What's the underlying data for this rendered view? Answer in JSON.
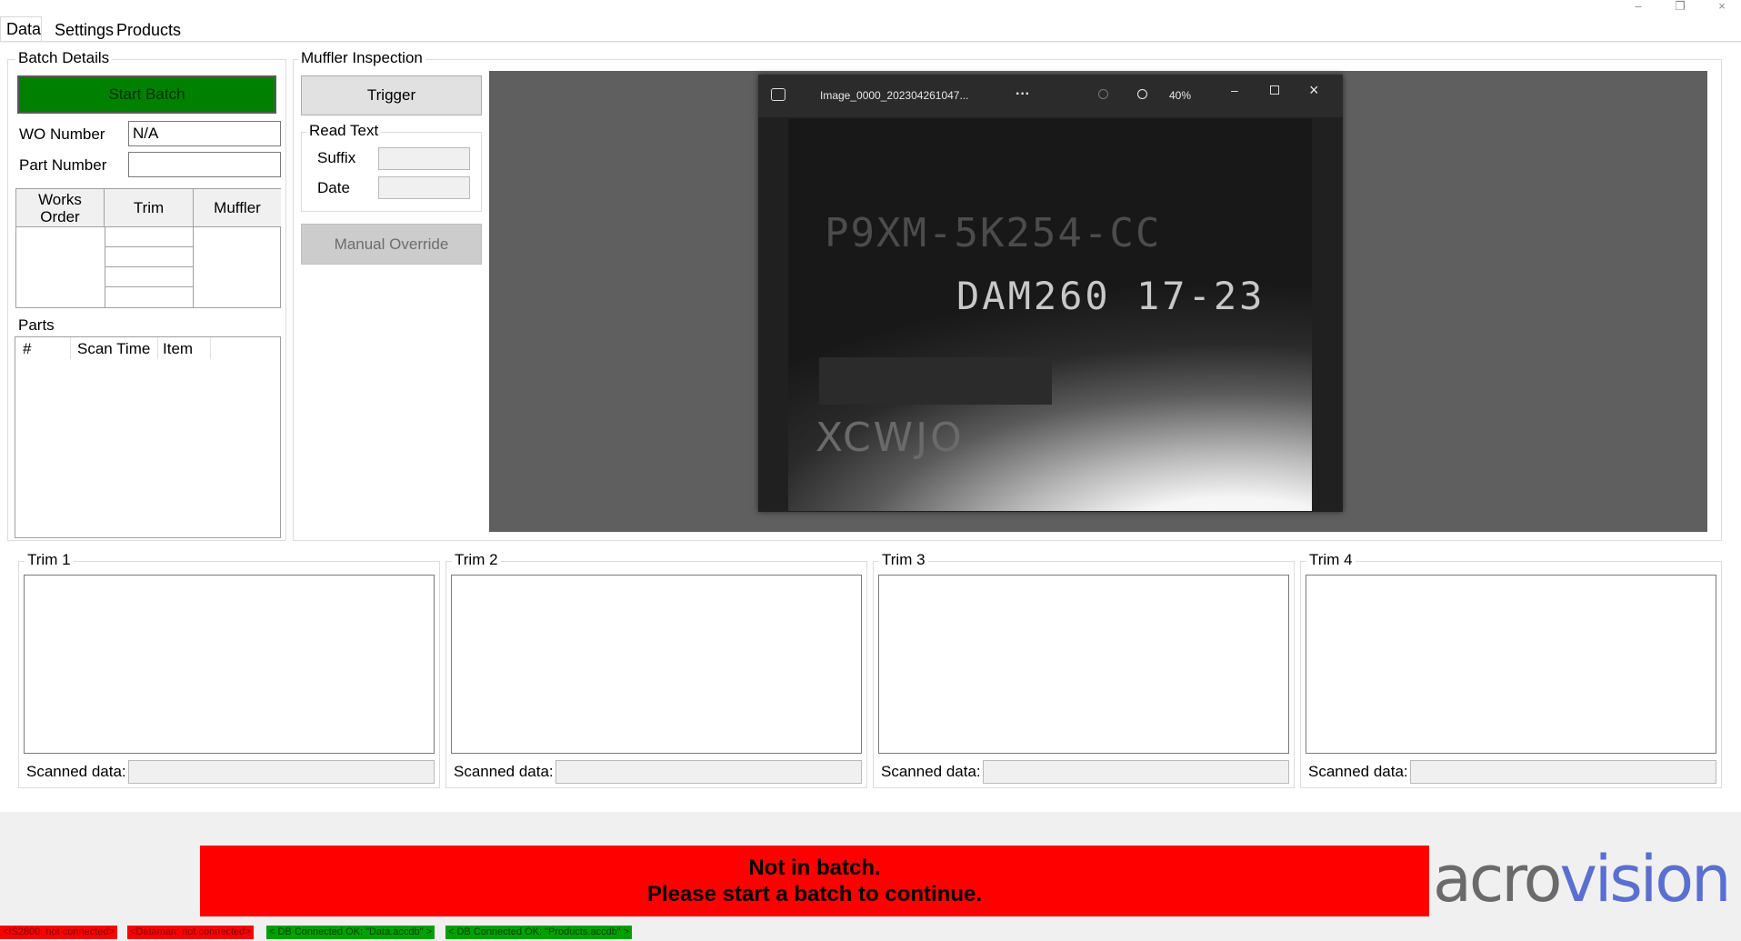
{
  "tabs": [
    "Data",
    "Settings",
    "Products"
  ],
  "window_controls": {
    "minimize": "–",
    "restore": "❐",
    "close": "×"
  },
  "batch_details": {
    "title": "Batch Details",
    "start_button": "Start Batch",
    "wo_number_label": "WO Number",
    "wo_number_value": "N/A",
    "part_number_label": "Part Number",
    "part_number_value": "",
    "grid_headers": {
      "works_order": "Works\nOrder",
      "trim": "Trim",
      "muffler": "Muffler"
    }
  },
  "parts": {
    "title": "Parts",
    "columns": [
      "#",
      "Scan Time",
      "Item"
    ]
  },
  "muffler_inspection": {
    "title": "Muffler Inspection",
    "trigger_button": "Trigger",
    "read_text_title": "Read Text",
    "suffix_label": "Suffix",
    "date_label": "Date",
    "manual_override_button": "Manual Override"
  },
  "photo_viewer": {
    "filename": "Image_0000_202304261047...",
    "more": "···",
    "zoom": "40%",
    "image_lines": [
      "P9XM-5K254-CC",
      "DAM260 17-23",
      "XCWJO"
    ]
  },
  "trims": [
    {
      "title": "Trim 1",
      "scanned_label": "Scanned data:",
      "scanned_value": ""
    },
    {
      "title": "Trim 2",
      "scanned_label": "Scanned data:",
      "scanned_value": ""
    },
    {
      "title": "Trim 3",
      "scanned_label": "Scanned data:",
      "scanned_value": ""
    },
    {
      "title": "Trim 4",
      "scanned_label": "Scanned data:",
      "scanned_value": ""
    }
  ],
  "banner": {
    "line1": "Not in batch.",
    "line2": "Please start a batch to continue."
  },
  "logo": {
    "text_dark": "acro",
    "text_blue": "vision"
  },
  "statusbar": [
    {
      "text": "<IS2800: not connected>",
      "color": "#ff0000"
    },
    {
      "text": "<Dataman: not connected>",
      "color": "#ff0000"
    },
    {
      "text": "< DB Connected OK: \"Data.accdb\" >",
      "color": "#00a000"
    },
    {
      "text": "< DB Connected OK: \"Products.accdb\" >",
      "color": "#00a000"
    }
  ],
  "colors": {
    "start_batch": "#008000",
    "banner": "#ff0000",
    "logo_blue": "#5a6fd0",
    "logo_gray": "#6a6a6a"
  }
}
